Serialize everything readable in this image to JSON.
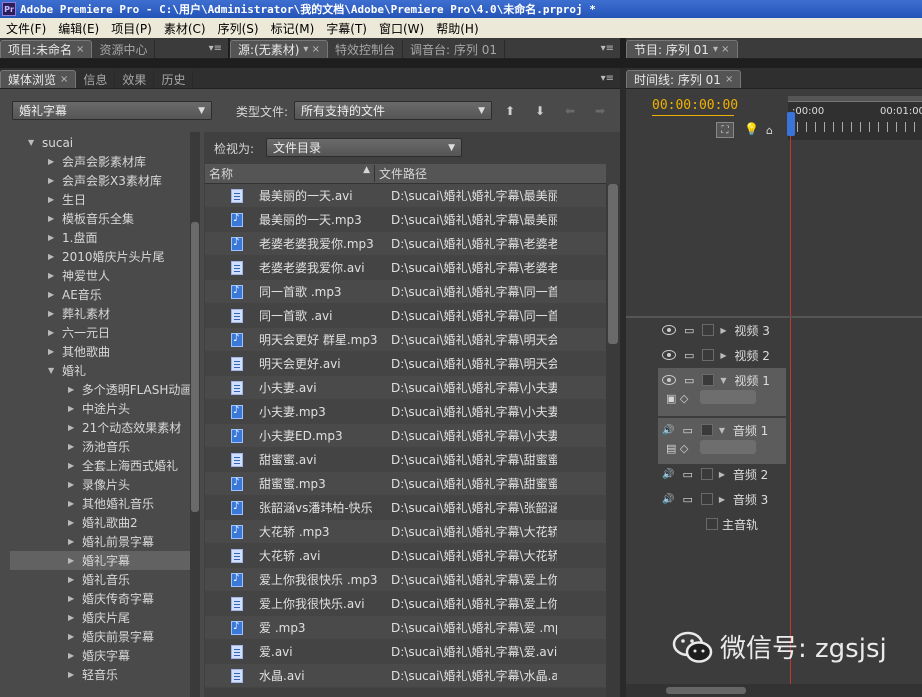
{
  "window": {
    "app_label": "Pr",
    "title": "Adobe Premiere Pro - C:\\用户\\Administrator\\我的文档\\Adobe\\Premiere Pro\\4.0\\未命名.prproj *"
  },
  "menu": [
    "文件(F)",
    "编辑(E)",
    "项目(P)",
    "素材(C)",
    "序列(S)",
    "标记(M)",
    "字幕(T)",
    "窗口(W)",
    "帮助(H)"
  ],
  "top_left_tabs": [
    {
      "label": "项目:未命名",
      "close": "×"
    },
    {
      "label": "资源中心"
    }
  ],
  "source_tabs": [
    {
      "label": "源:(无素材)"
    },
    {
      "label": "特效控制台"
    },
    {
      "label": "调音台: 序列 01"
    }
  ],
  "program_tab": {
    "label": "节目: 序列 01"
  },
  "browser_tabs": [
    {
      "label": "媒体浏览",
      "close": "×"
    },
    {
      "label": "信息"
    },
    {
      "label": "效果"
    },
    {
      "label": "历史"
    }
  ],
  "timeline_tab": {
    "label": "时间线: 序列 01",
    "close": "×"
  },
  "media_browser": {
    "location": "婚礼字幕",
    "file_type_label": "类型文件:",
    "file_type_value": "所有支持的文件",
    "view_as_label": "检视为:",
    "view_as_value": "文件目录",
    "col_name": "名称",
    "col_path": "文件路径"
  },
  "folders": [
    {
      "label": "sucai",
      "level": 1,
      "expanded": true
    },
    {
      "label": "会声会影素材库",
      "level": 2
    },
    {
      "label": "会声会影X3素材库",
      "level": 2
    },
    {
      "label": "生日",
      "level": 2
    },
    {
      "label": "模板音乐全集",
      "level": 2
    },
    {
      "label": "1.盘面",
      "level": 2
    },
    {
      "label": "2010婚庆片头片尾",
      "level": 2
    },
    {
      "label": "神爱世人",
      "level": 2
    },
    {
      "label": "AE音乐",
      "level": 2
    },
    {
      "label": "葬礼素材",
      "level": 2
    },
    {
      "label": "六一元日",
      "level": 2
    },
    {
      "label": "其他歌曲",
      "level": 2
    },
    {
      "label": "婚礼",
      "level": 2,
      "expanded": true
    },
    {
      "label": "多个透明FLASH动画",
      "level": 3
    },
    {
      "label": "中途片头",
      "level": 3
    },
    {
      "label": "21个动态效果素材",
      "level": 3
    },
    {
      "label": "汤池音乐",
      "level": 3
    },
    {
      "label": "全套上海西式婚礼",
      "level": 3
    },
    {
      "label": "录像片头",
      "level": 3
    },
    {
      "label": "其他婚礼音乐",
      "level": 3
    },
    {
      "label": "婚礼歌曲2",
      "level": 3
    },
    {
      "label": "婚礼前景字幕",
      "level": 3
    },
    {
      "label": "婚礼字幕",
      "level": 3,
      "selected": true
    },
    {
      "label": "婚礼音乐",
      "level": 3
    },
    {
      "label": "婚庆传奇字幕",
      "level": 3
    },
    {
      "label": "婚庆片尾",
      "level": 3
    },
    {
      "label": "婚庆前景字幕",
      "level": 3
    },
    {
      "label": "婚庆字幕",
      "level": 3
    },
    {
      "label": "轻音乐",
      "level": 3
    }
  ],
  "files": [
    {
      "name": "最美丽的一天.avi",
      "path": "D:\\sucai\\婚礼\\婚礼字幕\\最美丽",
      "type": "avi"
    },
    {
      "name": "最美丽的一天.mp3",
      "path": "D:\\sucai\\婚礼\\婚礼字幕\\最美丽",
      "type": "mp3"
    },
    {
      "name": "老婆老婆我爱你.mp3",
      "path": "D:\\sucai\\婚礼\\婚礼字幕\\老婆老",
      "type": "mp3"
    },
    {
      "name": "老婆老婆我爱你.avi",
      "path": "D:\\sucai\\婚礼\\婚礼字幕\\老婆老",
      "type": "avi"
    },
    {
      "name": "同一首歌 .mp3",
      "path": "D:\\sucai\\婚礼\\婚礼字幕\\同一首",
      "type": "mp3"
    },
    {
      "name": "同一首歌 .avi",
      "path": "D:\\sucai\\婚礼\\婚礼字幕\\同一首",
      "type": "avi"
    },
    {
      "name": "明天会更好 群星.mp3",
      "path": "D:\\sucai\\婚礼\\婚礼字幕\\明天会",
      "type": "mp3"
    },
    {
      "name": "明天会更好.avi",
      "path": "D:\\sucai\\婚礼\\婚礼字幕\\明天会",
      "type": "avi"
    },
    {
      "name": "小夫妻.avi",
      "path": "D:\\sucai\\婚礼\\婚礼字幕\\小夫妻",
      "type": "avi"
    },
    {
      "name": "小夫妻.mp3",
      "path": "D:\\sucai\\婚礼\\婚礼字幕\\小夫妻",
      "type": "mp3"
    },
    {
      "name": "小夫妻ED.mp3",
      "path": "D:\\sucai\\婚礼\\婚礼字幕\\小夫妻",
      "type": "mp3"
    },
    {
      "name": "甜蜜蜜.avi",
      "path": "D:\\sucai\\婚礼\\婚礼字幕\\甜蜜蜜",
      "type": "avi"
    },
    {
      "name": "甜蜜蜜.mp3",
      "path": "D:\\sucai\\婚礼\\婚礼字幕\\甜蜜蜜",
      "type": "mp3"
    },
    {
      "name": "张韶涵vs潘玮柏-快乐",
      "path": "D:\\sucai\\婚礼\\婚礼字幕\\张韶涵",
      "type": "mp3"
    },
    {
      "name": "大花轿 .mp3",
      "path": "D:\\sucai\\婚礼\\婚礼字幕\\大花轿",
      "type": "mp3"
    },
    {
      "name": "大花轿 .avi",
      "path": "D:\\sucai\\婚礼\\婚礼字幕\\大花轿",
      "type": "avi"
    },
    {
      "name": "爱上你我很快乐 .mp3",
      "path": "D:\\sucai\\婚礼\\婚礼字幕\\爱上你",
      "type": "mp3"
    },
    {
      "name": "爱上你我很快乐.avi",
      "path": "D:\\sucai\\婚礼\\婚礼字幕\\爱上你",
      "type": "avi"
    },
    {
      "name": "爱 .mp3",
      "path": "D:\\sucai\\婚礼\\婚礼字幕\\爱 .mp",
      "type": "mp3"
    },
    {
      "name": "爱.avi",
      "path": "D:\\sucai\\婚礼\\婚礼字幕\\爱.avi",
      "type": "avi"
    },
    {
      "name": "水晶.avi",
      "path": "D:\\sucai\\婚礼\\婚礼字幕\\水晶.a",
      "type": "avi"
    }
  ],
  "timeline": {
    "timecode": "00:00:00:00",
    "ruler_start": ":00:00",
    "ruler_next": "00:01:00",
    "tracks": [
      {
        "label": "视频 3",
        "kind": "video"
      },
      {
        "label": "视频 2",
        "kind": "video"
      },
      {
        "label": "视频 1",
        "kind": "video",
        "expanded": true
      },
      {
        "label": "音频 1",
        "kind": "audio",
        "expanded": true
      },
      {
        "label": "音频 2",
        "kind": "audio"
      },
      {
        "label": "音频 3",
        "kind": "audio"
      },
      {
        "label": "主音轨",
        "kind": "master"
      }
    ]
  },
  "watermark": {
    "text": "微信号: zgsjsj"
  },
  "colors": {
    "timecode": "#f0b000",
    "playhead": "#c0392b",
    "accent": "#ff9900"
  }
}
